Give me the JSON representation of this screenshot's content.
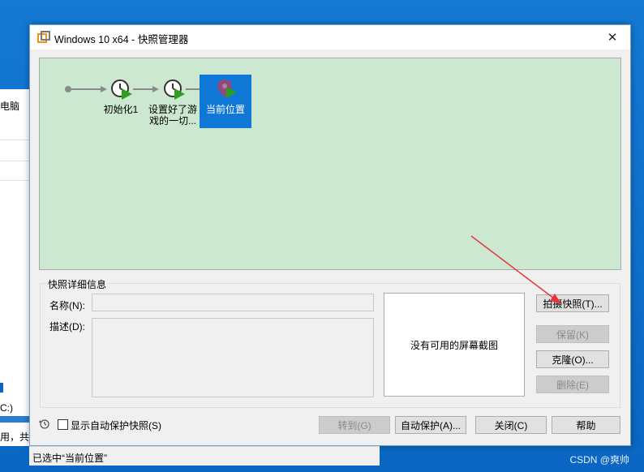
{
  "background": {
    "left_texts": [
      "电脑",
      "C:)",
      "用，共"
    ]
  },
  "dialog": {
    "title": "Windows 10 x64 - 快照管理器",
    "close_glyph": "✕"
  },
  "timeline": {
    "snapshots": [
      {
        "label_line1": "初始化1",
        "label_line2": ""
      },
      {
        "label_line1": "设置好了游",
        "label_line2": "戏的一切..."
      }
    ],
    "current": {
      "label": "当前位置"
    }
  },
  "details": {
    "group_title": "快照详细信息",
    "name_label": "名称(N):",
    "name_value": "",
    "desc_label": "描述(D):",
    "desc_value": "",
    "preview_text": "没有可用的屏幕截图"
  },
  "side_buttons": {
    "take": "拍摄快照(T)...",
    "keep": "保留(K)",
    "clone": "克隆(O)...",
    "delete": "删除(E)"
  },
  "bottom": {
    "show_auto_label": "显示自动保护快照(S)",
    "show_auto_checked": false,
    "goto": "转到(G)",
    "autoprotect": "自动保护(A)...",
    "close": "关闭(C)",
    "help": "帮助"
  },
  "status": {
    "text": "已选中“当前位置”"
  },
  "watermark": "CSDN @爽帅",
  "colors": {
    "timeline_bg": "#cde8d1",
    "selected": "#0f78d7",
    "arrow": "#e8343a"
  }
}
